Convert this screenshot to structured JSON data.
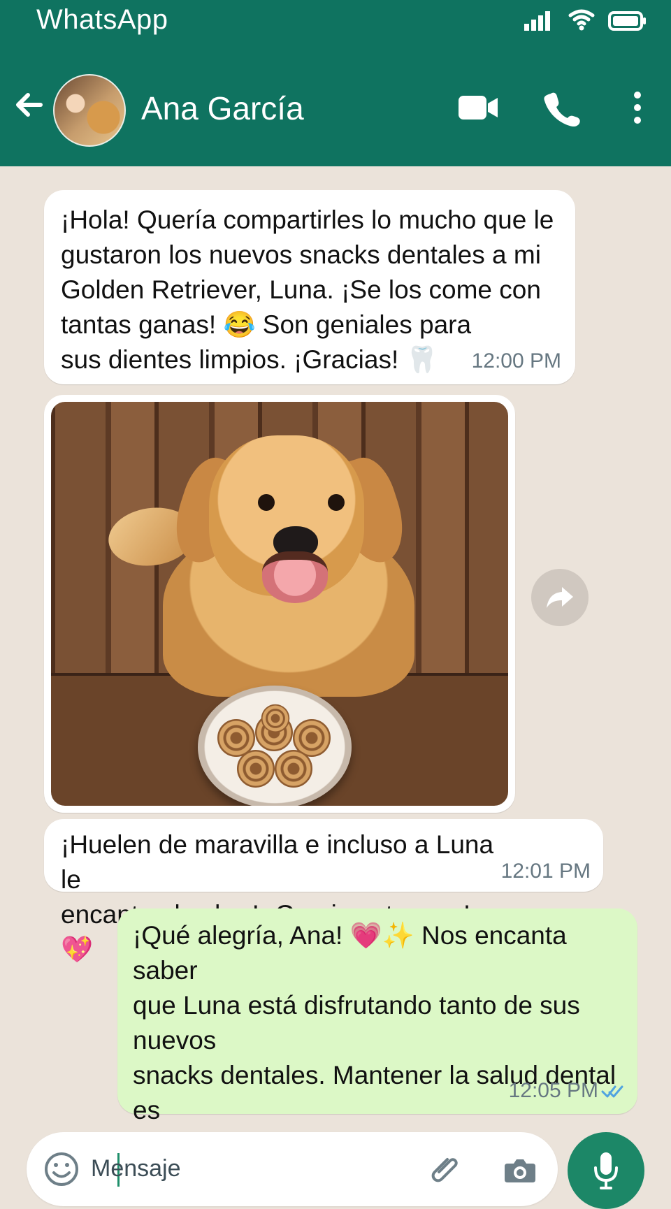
{
  "status_bar": {
    "app_name": "WhatsApp",
    "icons": [
      "signal-icon",
      "wifi-icon",
      "battery-icon"
    ]
  },
  "header": {
    "back_icon": "back-arrow-icon",
    "contact_name": "Ana García",
    "actions": [
      "video-call-icon",
      "phone-call-icon",
      "more-options-icon"
    ]
  },
  "chat": {
    "messages": [
      {
        "type": "incoming",
        "text": "¡Hola! Quería compartirles lo mucho que le\ngustaron los nuevos snacks dentales a mi\nGolden Retriever, Luna. ¡Se los come con\ntantas ganas! 😂 Son geniales para\nsus dientes limpios. ¡Gracias! 🦷",
        "time": "12:00 PM"
      },
      {
        "type": "incoming-image",
        "content": "photo"
      },
      {
        "type": "incoming",
        "text": "¡Huelen de maravilla e incluso a Luna le\nencanta el sabor! ¡Gracias otra vez! 💖",
        "time": "12:01 PM"
      },
      {
        "type": "outgoing",
        "text": "¡Qué alegría, Ana! 💗✨ Nos encanta saber\nque Luna está disfrutando tanto de sus nuevos\nsnacks dentales. Mantener la salud dental es\nmuy importante y nos alegra que Luna esté\nfeliz. ¡Muchas gracias por la foto y por confiar en\nnosotros! ¡Un abrazo para ambas!",
        "time": "12:05 PM",
        "status": "read"
      }
    ]
  },
  "composer": {
    "placeholder": "Mensaje",
    "icons": [
      "emoji-icon",
      "attachment-icon",
      "camera-icon",
      "microphone-icon"
    ]
  },
  "colors": {
    "header": "#0f7360",
    "incoming_bubble": "#ffffff",
    "outgoing_bubble": "#dcf8c6",
    "accent": "#1c8767",
    "chat_background": "#ebe3da"
  }
}
